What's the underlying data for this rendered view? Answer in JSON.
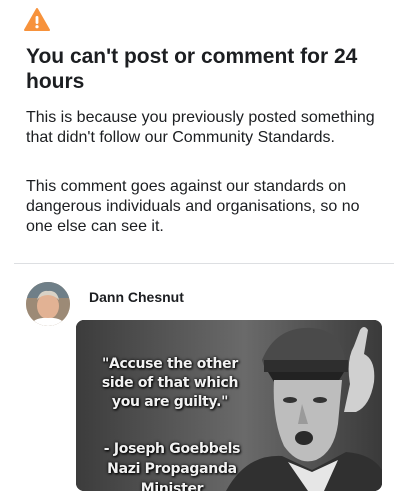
{
  "notice": {
    "icon": "warning-icon",
    "icon_color": "#f7923b",
    "title": "You can't post or comment for 24 hours",
    "reason": "This is because you previously posted something that didn't follow our Community Standards.",
    "detail": "This comment goes against our standards on dangerous individuals and organisations, so no one else can see it."
  },
  "comment": {
    "author": "Dann Chesnut",
    "image": {
      "quote": "\"Accuse the other side of that which you are guilty.\"",
      "attribution_name": "- Joseph Goebbels",
      "attribution_title": "Nazi Propaganda Minister"
    }
  }
}
